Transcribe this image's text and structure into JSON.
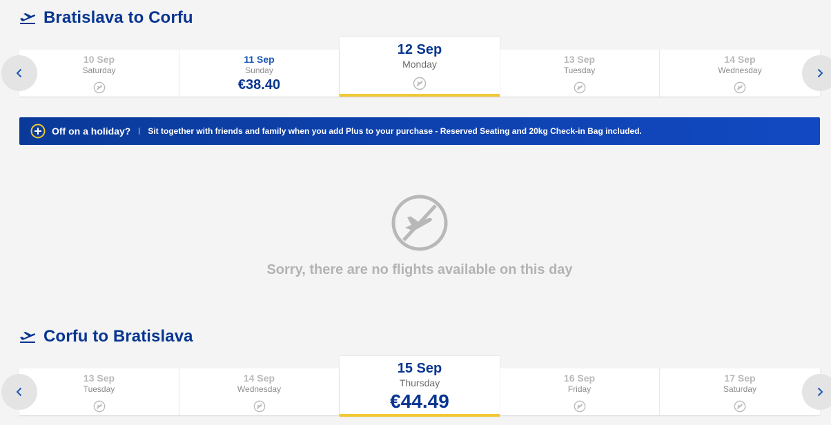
{
  "outbound": {
    "title": "Bratislava to Corfu",
    "days": [
      {
        "date": "10 Sep",
        "dow": "Saturday",
        "price": null
      },
      {
        "date": "11 Sep",
        "dow": "Sunday",
        "price": "€38.40"
      },
      {
        "date": "12 Sep",
        "dow": "Monday",
        "price": null,
        "selected": true
      },
      {
        "date": "13 Sep",
        "dow": "Tuesday",
        "price": null
      },
      {
        "date": "14 Sep",
        "dow": "Wednesday",
        "price": null
      }
    ]
  },
  "banner": {
    "headline": "Off on a holiday?",
    "message": "Sit together with friends and family when you add Plus to your purchase - Reserved Seating and 20kg Check-in Bag included."
  },
  "empty_state": {
    "message": "Sorry, there are no flights available on this day"
  },
  "inbound": {
    "title": "Corfu to Bratislava",
    "days": [
      {
        "date": "13 Sep",
        "dow": "Tuesday",
        "price": null
      },
      {
        "date": "14 Sep",
        "dow": "Wednesday",
        "price": null
      },
      {
        "date": "15 Sep",
        "dow": "Thursday",
        "price": "€44.49",
        "selected": true
      },
      {
        "date": "16 Sep",
        "dow": "Friday",
        "price": null
      },
      {
        "date": "17 Sep",
        "dow": "Saturday",
        "price": null
      }
    ]
  },
  "colors": {
    "brand_blue": "#073590",
    "accent_yellow": "#f1c933",
    "banner_blue": "#0a3a99"
  }
}
